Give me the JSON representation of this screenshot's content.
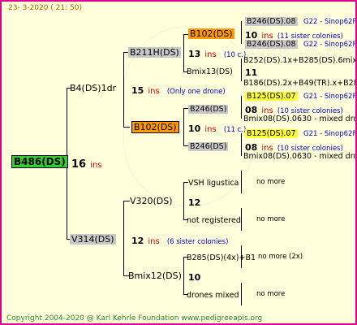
{
  "header": "23- 3-2020 ( 21: 50)",
  "footer": "Copyright 2004-2020 @ Karl Kehrle Foundation    www.pedigreeapis.org",
  "root": {
    "name": "B486(DS)",
    "number": "16",
    "ins": "ins"
  },
  "mother": {
    "name": "B4(DS)1dr",
    "number": "15",
    "ins": "ins",
    "note": "(Only one drone)"
  },
  "father": {
    "name": "V314(DS)",
    "number": "12",
    "ins": "ins",
    "note": "(6 sister colonies)"
  },
  "m_mother": {
    "name": "B211H(DS)",
    "number": "13",
    "ins": "ins",
    "note": "(10 c.)"
  },
  "m_father": {
    "name": "B102(DS)",
    "number": "10",
    "ins": "ins",
    "note": "(11 c.)"
  },
  "mm_mother": {
    "name": "B102(DS)",
    "number": "10",
    "ins": "ins",
    "note": "(11 sister colonies)"
  },
  "mm_father": {
    "name": "Bmix13(DS)",
    "number": "11"
  },
  "mf_mother": {
    "name": "B246(DS)",
    "number": "08",
    "ins": "ins",
    "note": "(10 sister colonies)"
  },
  "mf_father": {
    "name": "B246(DS)",
    "number": "08",
    "ins": "ins",
    "note": "(10 sister colonies)"
  },
  "gen4": {
    "a1": "B246(DS).08",
    "a1g": "G22 - Sinop62R",
    "a2": "B246(DS).08",
    "a2g": "G22 - Sinop62R",
    "b1": "B252(DS).1x+B285(DS).6mix1",
    "b2": "B186(DS).2x+B49(TR).x+B28",
    "c1": "B125(DS).07",
    "c1g": "G21 - Sinop62R",
    "c2": "Bmix08(DS).0630 - mixed drone",
    "d1": "B125(DS).07",
    "d1g": "G21 - Sinop62R",
    "d2": "Bmix08(DS).0630 - mixed drone"
  },
  "f_mother": {
    "name": "V320(DS)",
    "number": "12"
  },
  "f_father": {
    "name": "Bmix12(DS)",
    "number": "10"
  },
  "fm_mother": {
    "name": "VSH ligustica",
    "more": "no more"
  },
  "fm_father": {
    "name": "not registered",
    "more": "no more"
  },
  "ff_mother": {
    "name": "B285(DS)(4x)+B1",
    "more": "no more (2x)"
  },
  "ff_father": {
    "name": "drones mixed",
    "more": "no more"
  },
  "colors": {
    "border": "#e00090",
    "background": "#ffffdc",
    "root": "#33cc33",
    "highlight": "#ff9900",
    "yellow": "#ffff33",
    "gray": "#c8c8c8"
  }
}
